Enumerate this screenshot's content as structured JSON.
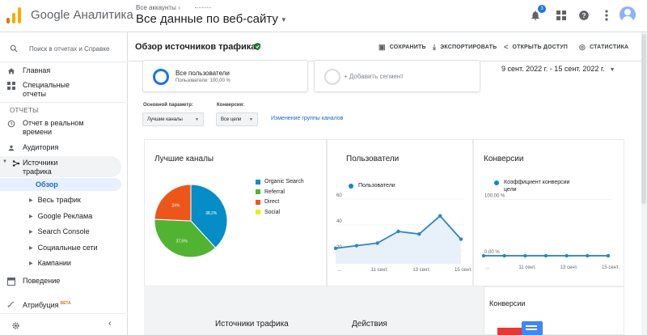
{
  "app": {
    "product_name": "Google Аналитика",
    "account_crumb": "Все аккаунты",
    "view_name": "Все данные по веб-сайту",
    "notification_count": "3"
  },
  "sidebar": {
    "search_label": "Поиск в отчетах и Справке",
    "section_reports": "ОТЧЕТЫ",
    "items": {
      "home": "Главная",
      "custom_reports": "Специальные отчеты",
      "realtime": "Отчет в реальном времени",
      "audience": "Аудитория",
      "acquisition": "Источники трафика",
      "behavior": "Поведение",
      "attribution": "Атрибуция",
      "attribution_badge": "BETA"
    },
    "acquisition_sub": {
      "overview": "Обзор",
      "all_traffic": "Весь трафик",
      "google_ads": "Google Реклама",
      "search_console": "Search Console",
      "social": "Социальные сети",
      "campaigns": "Кампании"
    }
  },
  "header": {
    "title": "Обзор источников трафика",
    "actions": {
      "save": "СОХРАНИТЬ",
      "export": "ЭКСПОРТИРОВАТЬ",
      "share": "ОТКРЫТЬ ДОСТУП",
      "insights": "СТАТИСТИКА"
    }
  },
  "segments": {
    "all_users_title": "Все пользователи",
    "all_users_sub": "Пользователи: 100,00 %",
    "add_segment": "+ Добавить сегмент"
  },
  "date_range": "9 сент. 2022 г. - 15 сент. 2022 г.",
  "controls": {
    "primary_dimension_label": "Основной параметр:",
    "primary_dimension_value": "Лучшие каналы",
    "conversion_label": "Конверсия:",
    "conversion_value": "Все цели",
    "edit_channel_group": "Изменение группы каналов"
  },
  "colors": {
    "organic": "#058dc7",
    "referral": "#50b432",
    "direct": "#ed561b",
    "social": "#edef00",
    "line": "#2e86c1",
    "accent": "#1a73e8"
  },
  "panels": {
    "channels_title": "Лучшие каналы",
    "users_title": "Пользователи",
    "conversions_title": "Конверсии",
    "users_legend": "Пользователи",
    "conv_legend": "Коэффициент конверсии цели"
  },
  "chart_data": [
    {
      "type": "pie",
      "title": "Лучшие каналы",
      "categories": [
        "Organic Search",
        "Referral",
        "Direct",
        "Social"
      ],
      "values": [
        38.2,
        37.5,
        24.3,
        0
      ],
      "labels": [
        "38,2%",
        "37,5%",
        "24%",
        ""
      ]
    },
    {
      "type": "line",
      "title": "Пользователи",
      "x": [
        "9 сент.",
        "10 сент.",
        "11 сент.",
        "12 сент.",
        "13 сент.",
        "14 сент.",
        "15 сент."
      ],
      "x_tick_labels": [
        "...",
        "11 сент.",
        "13 сент.",
        "15 сент."
      ],
      "y_tick_labels": [
        "20",
        "40",
        "60"
      ],
      "series": [
        {
          "name": "Пользователи",
          "values": [
            22,
            24,
            26,
            35,
            33,
            47,
            29
          ]
        }
      ],
      "ylim": [
        10,
        65
      ]
    },
    {
      "type": "line",
      "title": "Конверсии",
      "x": [
        "9 сент.",
        "10 сент.",
        "11 сент.",
        "12 сент.",
        "13 сент.",
        "14 сент.",
        "15 сент."
      ],
      "x_tick_labels": [
        "...",
        "11 сент.",
        "13 сент.",
        "15 сент."
      ],
      "y_tick_labels": [
        "0,00 %",
        "100,00 %"
      ],
      "series": [
        {
          "name": "Коэффициент конверсии цели",
          "values": [
            0,
            0,
            0,
            0,
            0,
            0,
            0
          ]
        }
      ],
      "ylim": [
        -10,
        105
      ]
    }
  ],
  "bottom": {
    "traffic_sources": "Источники трафика",
    "actions": "Действия",
    "conversions": "Конверсии"
  }
}
